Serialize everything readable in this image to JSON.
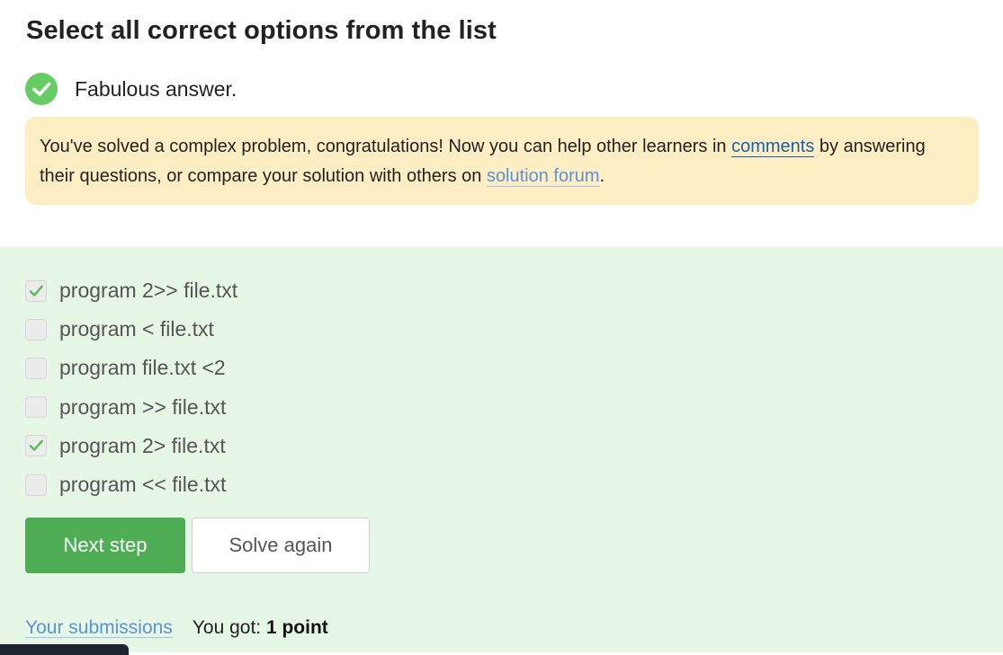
{
  "page": {
    "title": "Select all correct options from the list"
  },
  "result": {
    "icon": "check-circle-icon",
    "text": "Fabulous answer."
  },
  "notice": {
    "text_1": "You've solved a complex problem, congratulations! Now you can help other learners in ",
    "comments_link": "comments",
    "text_2": " by answering their questions, or compare your solution with others on ",
    "forum_link": "solution forum",
    "text_3": "."
  },
  "options": [
    {
      "label": "program 2>> file.txt",
      "checked": true
    },
    {
      "label": "program < file.txt",
      "checked": false
    },
    {
      "label": "program file.txt <2",
      "checked": false
    },
    {
      "label": "program >> file.txt",
      "checked": false
    },
    {
      "label": "program 2> file.txt",
      "checked": true
    },
    {
      "label": "program << file.txt",
      "checked": false
    }
  ],
  "buttons": {
    "next": "Next step",
    "solve_again": "Solve again"
  },
  "footer": {
    "submissions_link": "Your submissions",
    "score_prefix": "You got: ",
    "score_value": "1 point"
  },
  "colors": {
    "success": "#66cc66",
    "primary_button": "#4fae55",
    "notice_bg": "#ffeec4",
    "options_bg": "#e6f7e6",
    "link": "#5b93d8"
  }
}
